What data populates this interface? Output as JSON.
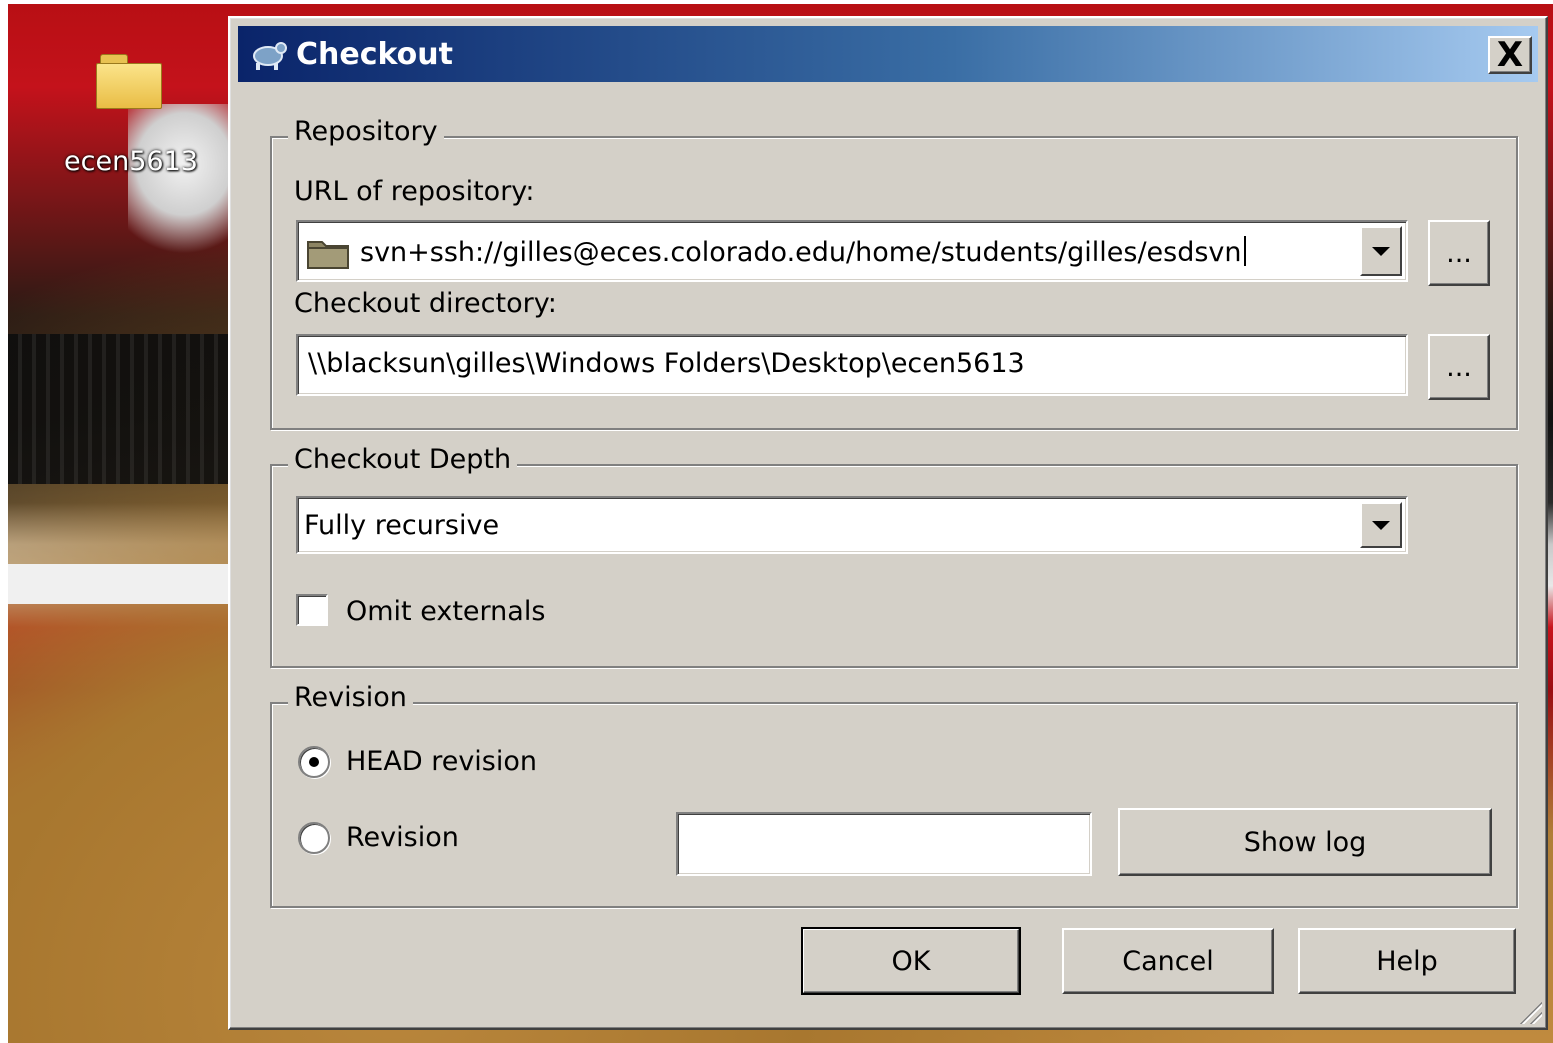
{
  "desktop": {
    "icon_label": "ecen5613"
  },
  "dialog": {
    "title": "Checkout",
    "close_label": "X",
    "repository": {
      "legend": "Repository",
      "url_label": "URL of repository:",
      "url_value": "svn+ssh://gilles@eces.colorado.edu/home/students/gilles/esdsvn",
      "url_browse_label": "...",
      "dir_label": "Checkout directory:",
      "dir_value": "\\\\blacksun\\gilles\\Windows Folders\\Desktop\\ecen5613",
      "dir_browse_label": "..."
    },
    "depth": {
      "legend": "Checkout Depth",
      "selected": "Fully recursive",
      "omit_externals_label": "Omit externals",
      "omit_externals_checked": false
    },
    "revision": {
      "legend": "Revision",
      "head_label": "HEAD revision",
      "head_selected": true,
      "revision_label": "Revision",
      "revision_value": "",
      "show_log_label": "Show log"
    },
    "buttons": {
      "ok": "OK",
      "cancel": "Cancel",
      "help": "Help"
    }
  },
  "colors": {
    "dialog_face": "#d4d0c8",
    "title_start": "#0a246a",
    "title_end": "#a6caf0"
  }
}
